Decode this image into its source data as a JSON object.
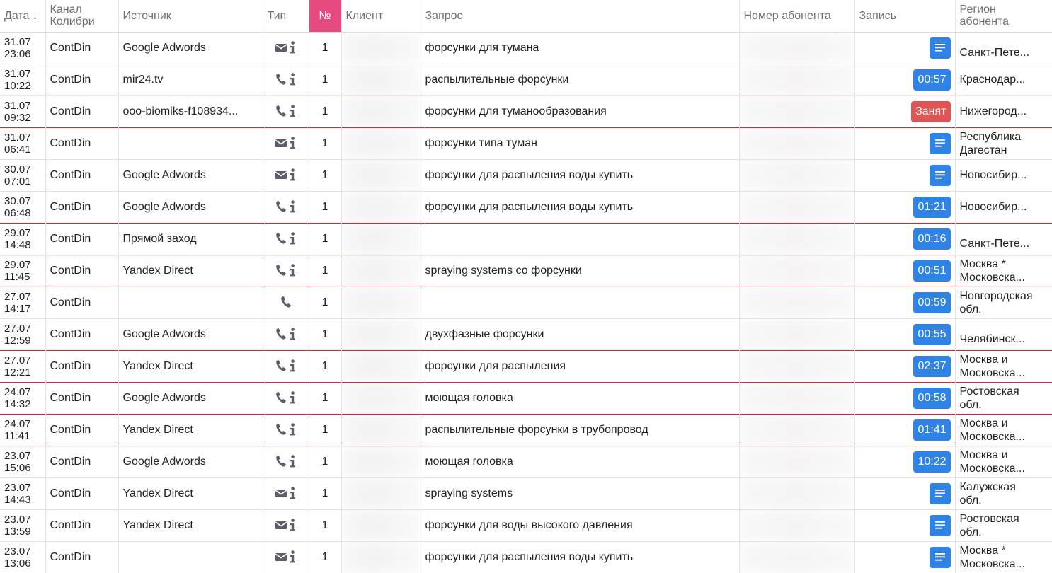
{
  "header": {
    "date": "Дата",
    "sort_arrow": "↓",
    "channel_1": "Канал",
    "channel_2": "Колибри",
    "source": "Источник",
    "type": "Тип",
    "num": "№",
    "client": "Клиент",
    "query": "Запрос",
    "phone": "Номер абонента",
    "record": "Запись",
    "region_1": "Регион",
    "region_2": "абонента"
  },
  "colors": {
    "accent_pink": "#e54b80",
    "badge_blue": "#2f82e6",
    "badge_red": "#df5454",
    "row_highlight": "#d42a2a"
  },
  "rows": [
    {
      "d": "31.07",
      "t": "23:06",
      "ch": "ContDin",
      "src": "Google Adwords",
      "type": "mail",
      "n": "1",
      "q": "форсунки для тумана",
      "rec": "",
      "rec_kind": "text",
      "reg1": "Санкт-Пете...",
      "reg2": "",
      "reg_kind": "one",
      "hl": false
    },
    {
      "d": "31.07",
      "t": "10:22",
      "ch": "ContDin",
      "src": "mir24.tv",
      "type": "phone",
      "n": "1",
      "q": "распылительные форсунки",
      "rec": "00:57",
      "rec_kind": "time",
      "reg1": "Краснодар...",
      "reg2": "",
      "reg_kind": "mid",
      "hl": false
    },
    {
      "d": "31.07",
      "t": "09:32",
      "ch": "ContDin",
      "src": "ooo-biomiks-f108934...",
      "type": "phone",
      "n": "1",
      "q": "форсунки для туманообразования",
      "rec": "Занят",
      "rec_kind": "busy",
      "reg1": "Нижегород...",
      "reg2": "",
      "reg_kind": "mid",
      "hl": true
    },
    {
      "d": "31.07",
      "t": "06:41",
      "ch": "ContDin",
      "src": "",
      "type": "mail",
      "n": "1",
      "q": "форсунки типа туман",
      "rec": "",
      "rec_kind": "text",
      "reg1": "Республика",
      "reg2": "Дагестан",
      "reg_kind": "two",
      "hl": true
    },
    {
      "d": "30.07",
      "t": "07:01",
      "ch": "ContDin",
      "src": "Google Adwords",
      "type": "mail",
      "n": "1",
      "q": "форсунки для распыления воды купить",
      "rec": "",
      "rec_kind": "text",
      "reg1": "Новосибир...",
      "reg2": "",
      "reg_kind": "mid",
      "hl": false
    },
    {
      "d": "30.07",
      "t": "06:48",
      "ch": "ContDin",
      "src": "Google Adwords",
      "type": "phone",
      "n": "1",
      "q": "форсунки для распыления воды купить",
      "rec": "01:21",
      "rec_kind": "time",
      "reg1": "Новосибир...",
      "reg2": "",
      "reg_kind": "mid",
      "hl": false
    },
    {
      "d": "29.07",
      "t": "14:48",
      "ch": "ContDin",
      "src": "Прямой заход",
      "type": "phone",
      "n": "1",
      "q": "",
      "rec": "00:16",
      "rec_kind": "time",
      "reg1": "Санкт-Пете...",
      "reg2": "",
      "reg_kind": "one",
      "hl": true
    },
    {
      "d": "29.07",
      "t": "11:45",
      "ch": "ContDin",
      "src": "Yandex Direct",
      "type": "phone",
      "n": "1",
      "q": "spraying systems со форсунки",
      "rec": "00:51",
      "rec_kind": "time",
      "reg1": "Москва *",
      "reg2": "Московска...",
      "reg_kind": "two",
      "hl": true
    },
    {
      "d": "27.07",
      "t": "14:17",
      "ch": "ContDin",
      "src": "",
      "type": "phone-only",
      "n": "1",
      "q": "",
      "rec": "00:59",
      "rec_kind": "time",
      "reg1": "Новгородская",
      "reg2": "обл.",
      "reg_kind": "two",
      "hl": true
    },
    {
      "d": "27.07",
      "t": "12:59",
      "ch": "ContDin",
      "src": "Google Adwords",
      "type": "phone",
      "n": "1",
      "q": "двухфазные форсунки",
      "rec": "00:55",
      "rec_kind": "time",
      "reg1": "Челябинск...",
      "reg2": "",
      "reg_kind": "one",
      "hl": false
    },
    {
      "d": "27.07",
      "t": "12:21",
      "ch": "ContDin",
      "src": "Yandex Direct",
      "type": "phone",
      "n": "1",
      "q": "форсунки для распыления",
      "rec": "02:37",
      "rec_kind": "time",
      "reg1": "Москва и",
      "reg2": "Московска...",
      "reg_kind": "two",
      "hl": true
    },
    {
      "d": "24.07",
      "t": "14:32",
      "ch": "ContDin",
      "src": "Google Adwords",
      "type": "phone",
      "n": "1",
      "q": "моющая головка",
      "rec": "00:58",
      "rec_kind": "time",
      "reg1": "Ростовская",
      "reg2": "обл.",
      "reg_kind": "two",
      "hl": true
    },
    {
      "d": "24.07",
      "t": "11:41",
      "ch": "ContDin",
      "src": "Yandex Direct",
      "type": "phone",
      "n": "1",
      "q": "распылительные форсунки в трубопровод",
      "rec": "01:41",
      "rec_kind": "time",
      "reg1": "Москва и",
      "reg2": "Московска...",
      "reg_kind": "two",
      "hl": true
    },
    {
      "d": "23.07",
      "t": "15:06",
      "ch": "ContDin",
      "src": "Google Adwords",
      "type": "phone",
      "n": "1",
      "q": "моющая головка",
      "rec": "10:22",
      "rec_kind": "time",
      "reg1": "Москва и",
      "reg2": "Московска...",
      "reg_kind": "two",
      "hl": true
    },
    {
      "d": "23.07",
      "t": "14:43",
      "ch": "ContDin",
      "src": "Yandex Direct",
      "type": "mail",
      "n": "1",
      "q": "spraying systems",
      "rec": "",
      "rec_kind": "text",
      "reg1": "Калужская",
      "reg2": "обл.",
      "reg_kind": "two",
      "hl": false
    },
    {
      "d": "23.07",
      "t": "13:59",
      "ch": "ContDin",
      "src": "Yandex Direct",
      "type": "mail",
      "n": "1",
      "q": "форсунки для воды высокого давления",
      "rec": "",
      "rec_kind": "text",
      "reg1": "Ростовская",
      "reg2": "обл.",
      "reg_kind": "two",
      "hl": false
    },
    {
      "d": "23.07",
      "t": "13:06",
      "ch": "ContDin",
      "src": "",
      "type": "mail",
      "n": "1",
      "q": "форсунки для распыления воды купить",
      "rec": "",
      "rec_kind": "text",
      "reg1": "Москва *",
      "reg2": "Московска...",
      "reg_kind": "two",
      "hl": false
    }
  ]
}
